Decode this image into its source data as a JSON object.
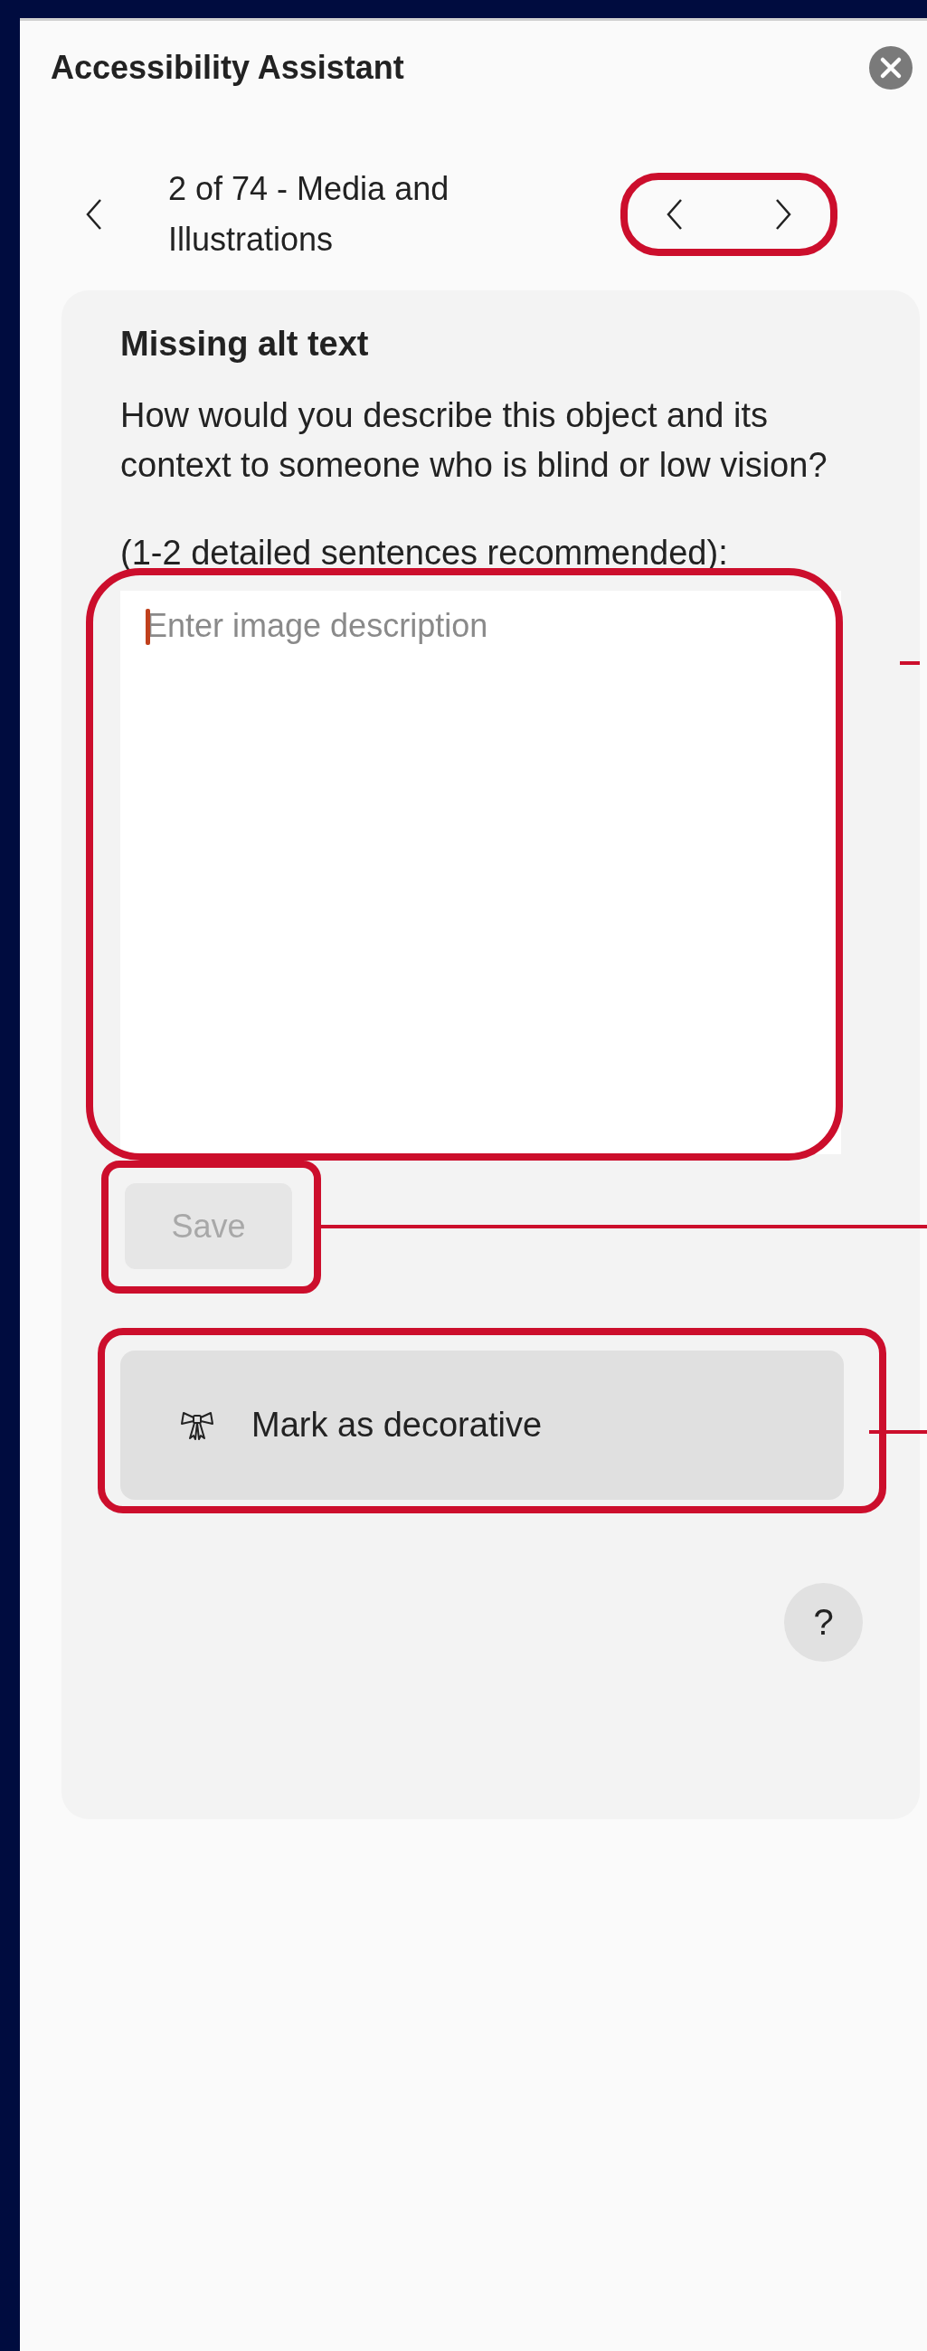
{
  "panel": {
    "title": "Accessibility Assistant"
  },
  "navigation": {
    "label": "2 of 74 - Media and Illustrations",
    "highlighted": true
  },
  "issue": {
    "title": "Missing alt text",
    "question": "How would you describe this object and its context to someone who is blind or low vision?",
    "hint": "(1-2 detailed sentences recommended):"
  },
  "description_field": {
    "placeholder": "Enter image description",
    "focused": true,
    "highlighted": true,
    "callout": true
  },
  "save_button": {
    "label": "Save",
    "disabled": true,
    "highlighted": true,
    "callout": true
  },
  "decorative_button": {
    "label": "Mark as decorative",
    "highlighted": true,
    "callout": true
  },
  "help_button": {
    "label": "?"
  }
}
